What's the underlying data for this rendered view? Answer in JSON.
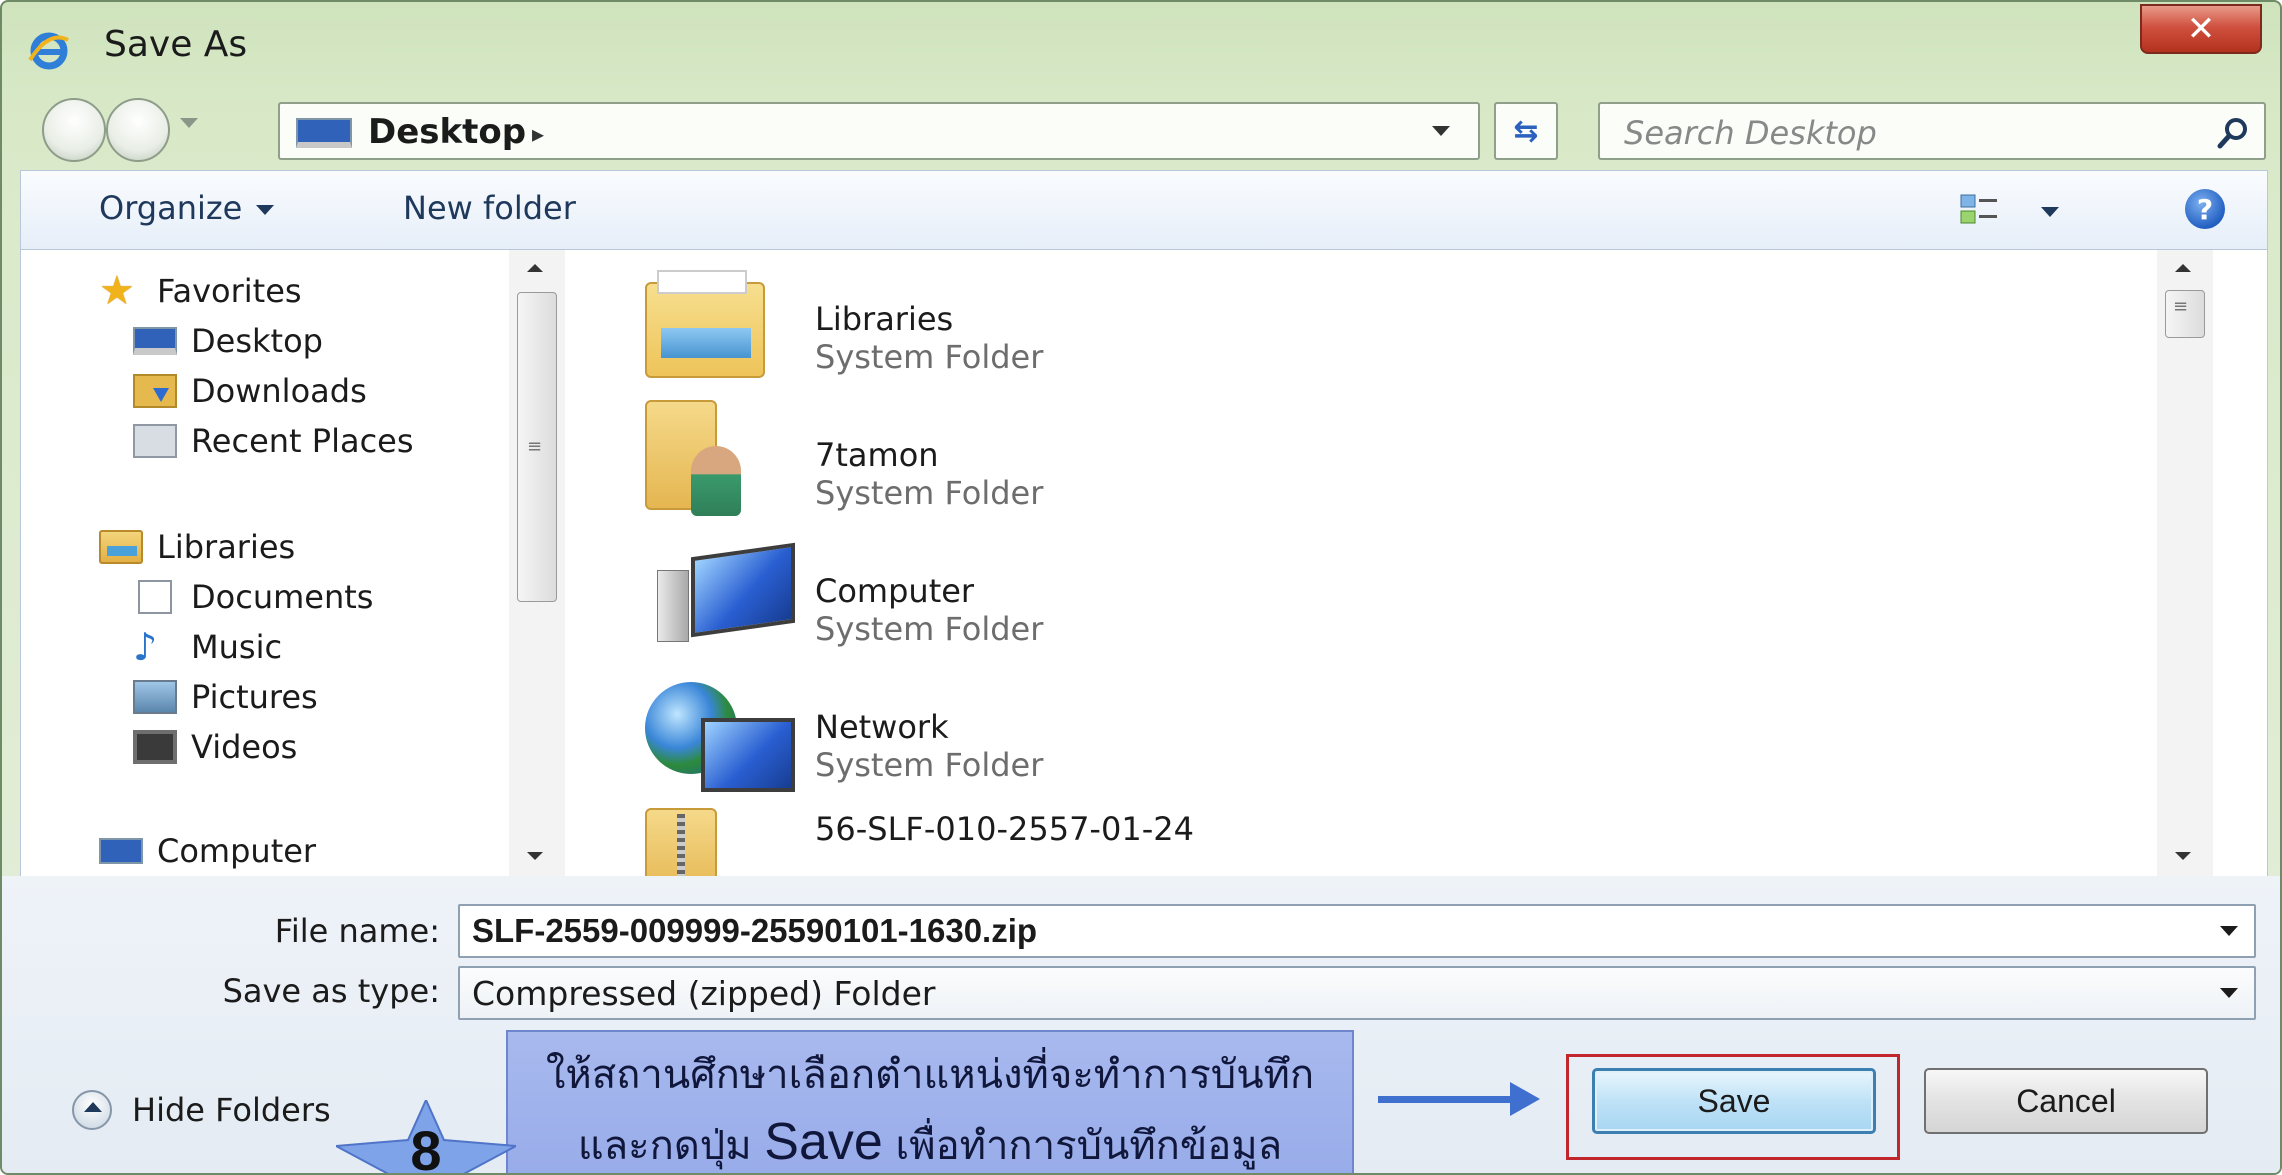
{
  "window": {
    "title": "Save As",
    "close_label": "✕"
  },
  "address_bar": {
    "location": "Desktop",
    "separator": "▸"
  },
  "search": {
    "placeholder": "Search Desktop"
  },
  "toolbar": {
    "organize_label": "Organize",
    "new_folder_label": "New folder",
    "help_label": "?"
  },
  "nav_pane": {
    "items": [
      {
        "label": "Favorites",
        "icon": "star-icon"
      },
      {
        "label": "Desktop",
        "icon": "desktop-icon"
      },
      {
        "label": "Downloads",
        "icon": "downloads-icon"
      },
      {
        "label": "Recent Places",
        "icon": "recent-places-icon"
      },
      {
        "label": "Libraries",
        "icon": "libraries-icon"
      },
      {
        "label": "Documents",
        "icon": "documents-icon"
      },
      {
        "label": "Music",
        "icon": "music-icon"
      },
      {
        "label": "Pictures",
        "icon": "pictures-icon"
      },
      {
        "label": "Videos",
        "icon": "videos-icon"
      },
      {
        "label": "Computer",
        "icon": "computer-icon"
      }
    ]
  },
  "files": [
    {
      "name": "Libraries",
      "type": "System Folder",
      "icon": "libraries-folder-icon"
    },
    {
      "name": "7tamon",
      "type": "System Folder",
      "icon": "user-folder-icon"
    },
    {
      "name": "Computer",
      "type": "System Folder",
      "icon": "computer-icon"
    },
    {
      "name": "Network",
      "type": "System Folder",
      "icon": "network-icon"
    },
    {
      "name": "56-SLF-010-2557-01-24",
      "type": "",
      "icon": "zip-folder-icon"
    }
  ],
  "form": {
    "file_name_label": "File name:",
    "file_name_value": "SLF-2559-009999-25590101-1630.zip",
    "save_type_label": "Save as type:",
    "save_type_value": "Compressed (zipped) Folder",
    "hide_folders_label": "Hide Folders",
    "save_label": "Save",
    "cancel_label": "Cancel"
  },
  "annotation": {
    "line1": "ให้สถานศึกษาเลือกตำแหน่งที่จะทำการบันทึก",
    "line2_pre": "และกดปุ่ม ",
    "line2_save": "Save",
    "line2_post": " เพื่อทำการบันทึกข้อมูล",
    "step_number": "8"
  },
  "colors": {
    "highlight": "#c0262b",
    "arrow": "#3f6fcf",
    "callout_bg": "#a8b9ee"
  }
}
